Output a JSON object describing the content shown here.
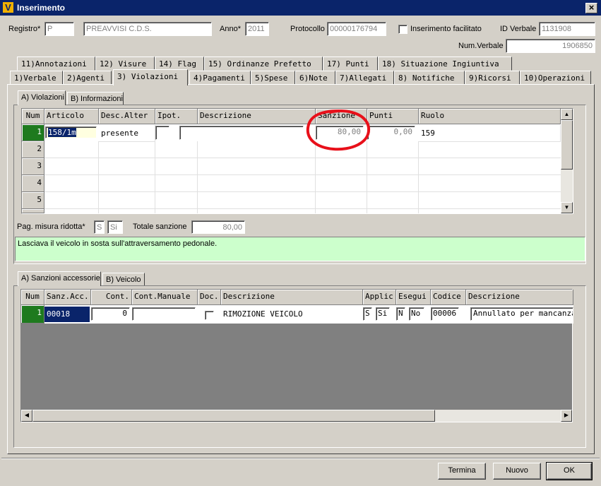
{
  "window": {
    "title": "Inserimento",
    "icon_glyph": "V",
    "close_glyph": "×"
  },
  "header": {
    "registro_label": "Registro*",
    "registro_code": "P",
    "registro_desc": "PREAVVISI C.D.S.",
    "anno_label": "Anno*",
    "anno_value": "2011",
    "protocollo_label": "Protocollo",
    "protocollo_value": "00000176794",
    "facilitato_label": "Inserimento facilitato",
    "id_verbale_label": "ID Verbale",
    "id_verbale_value": "1131908",
    "num_verbale_label": "Num.Verbale",
    "num_verbale_value": "1906850"
  },
  "tabs_row1": [
    {
      "key": "11",
      "label": "11)Annotazioni"
    },
    {
      "key": "12",
      "label": "12) Visure"
    },
    {
      "key": "14",
      "label": "14) Flag"
    },
    {
      "key": "15",
      "label": "15) Ordinanze Prefetto"
    },
    {
      "key": "17",
      "label": "17) Punti"
    },
    {
      "key": "18",
      "label": "18) Situazione Ingiuntiva"
    }
  ],
  "tabs_row2": [
    {
      "label": "1)Verbale"
    },
    {
      "label": "2)Agenti"
    },
    {
      "label": "3) Violazioni"
    },
    {
      "label": "4)Pagamenti"
    },
    {
      "label": "5)Spese"
    },
    {
      "label": "6)Note"
    },
    {
      "label": "7)Allegati"
    },
    {
      "label": "8) Notifiche"
    },
    {
      "label": "9)Ricorsi"
    },
    {
      "label": "10)Operazioni"
    }
  ],
  "violazioni_tabs": [
    {
      "label": "A) Violazioni"
    },
    {
      "label": "B) Informazioni"
    }
  ],
  "violazioni_grid": {
    "headers": [
      "Num",
      "Articolo",
      "Desc.Alter",
      "Ipot.",
      "Descrizione",
      "Sanzione",
      "Punti",
      "Ruolo"
    ],
    "row1": {
      "num": "1",
      "articolo": "158/1m",
      "desc_alter": "presente",
      "ipot": "",
      "descrizione": "",
      "sanzione": "80,00",
      "punti": "0,00",
      "ruolo": "159"
    },
    "row_numbers": [
      "2",
      "3",
      "4",
      "5"
    ]
  },
  "pagamento": {
    "label": "Pag. misura ridotta*",
    "code": "S",
    "value": "Si",
    "totale_label": "Totale sanzione",
    "totale_value": "80,00"
  },
  "note_text": "Lasciava il veicolo in sosta sull'attraversamento pedonale.",
  "sanzioni_tabs": [
    {
      "label": "A) Sanzioni accessorie"
    },
    {
      "label": "B) Veicolo"
    }
  ],
  "sanzioni_grid": {
    "headers": [
      "Num",
      "Sanz.Acc.",
      "Cont.",
      "Cont.Manuale",
      "Doc.",
      "Descrizione",
      "Applic",
      "Esegui",
      "Codice",
      "Descrizione"
    ],
    "row1": {
      "num": "1",
      "sanz_acc": "00018",
      "cont": "0",
      "cont_manuale": "",
      "descrizione": "RIMOZIONE VEICOLO",
      "applic_code": "S",
      "applic_value": "Si",
      "esegui_code": "N",
      "esegui_value": "No",
      "codice": "00006",
      "descrizione2": "Annullato per mancanza"
    }
  },
  "buttons": {
    "termina": "Termina",
    "nuovo": "Nuovo",
    "ok": "OK"
  },
  "colors": {
    "titlebar": "#0a246a",
    "selected_row": "#1e7a1e",
    "note_bg": "#ccffcc",
    "highlight": "#e8101a"
  }
}
